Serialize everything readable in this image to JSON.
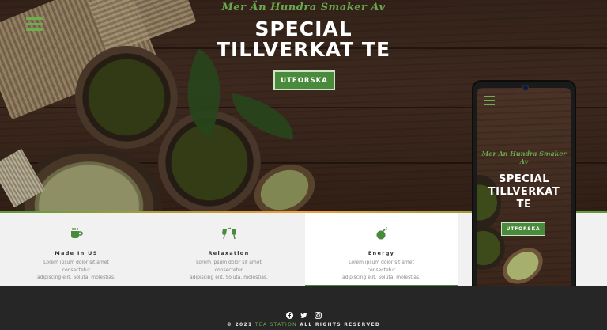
{
  "hero": {
    "subtitle": "Mer Än Hundra Smaker Av",
    "title_line1": "SPECIAL",
    "title_line2": "TILLVERKAT TE",
    "cta_label": "UTFORSKA"
  },
  "features": [
    {
      "icon": "coffee-cup-icon",
      "title": "Made In US",
      "text_line1": "Lorem ipsum dolor sit amet consectetur",
      "text_line2": "adipiscing elit. Soluta, molestias."
    },
    {
      "icon": "toast-glasses-icon",
      "title": "Relaxation",
      "text_line1": "Lorem ipsum dolor sit amet consectetur",
      "text_line2": "adipiscing elit. Soluta, molestias."
    },
    {
      "icon": "bomb-icon",
      "title": "Energy",
      "text_line1": "Lorem ipsum dolor sit amet consectetur",
      "text_line2": "adipiscing elit. Soluta, molestias."
    }
  ],
  "phone_preview": {
    "subtitle": "Mer Än Hundra Smaker Av",
    "title_line1": "SPECIAL",
    "title_line2": "TILLVERKAT",
    "title_line3": "TE",
    "cta_label": "UTFORSKA"
  },
  "footer": {
    "social": [
      "facebook-icon",
      "twitter-icon",
      "instagram-icon"
    ],
    "copyright_prefix": "© 2021",
    "brand": "TEA STATION",
    "copyright_suffix": "ALL RIGHTS RESERVED"
  },
  "colors": {
    "accent_green": "#4a8a3c",
    "title_green": "#6aa84f",
    "footer_bg": "#262626",
    "features_bg": "#f1f1f1"
  }
}
